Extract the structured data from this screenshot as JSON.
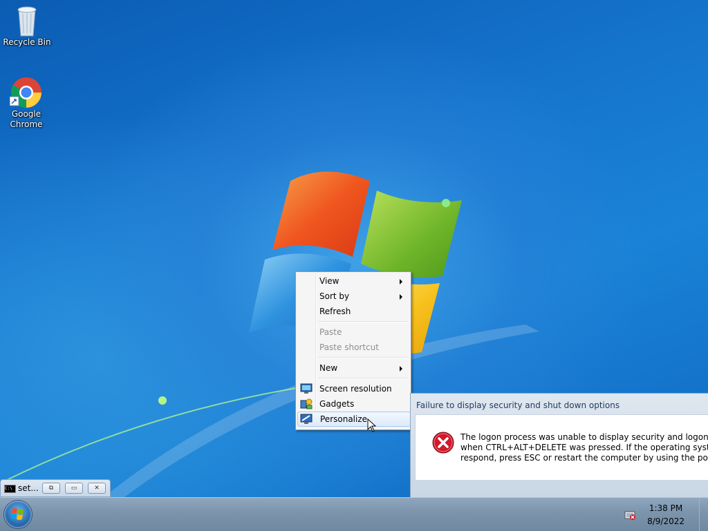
{
  "desktop": {
    "icons": [
      {
        "label": "Recycle Bin",
        "icon": "recycle-bin-icon"
      },
      {
        "label": "Google\nChrome",
        "icon": "chrome-icon"
      }
    ]
  },
  "context_menu": {
    "items": [
      {
        "label": "View",
        "submenu": true,
        "enabled": true
      },
      {
        "label": "Sort by",
        "submenu": true,
        "enabled": true
      },
      {
        "label": "Refresh",
        "enabled": true
      },
      {
        "label": "Paste",
        "enabled": false
      },
      {
        "label": "Paste shortcut",
        "enabled": false
      },
      {
        "label": "New",
        "submenu": true,
        "enabled": true
      },
      {
        "label": "Screen resolution",
        "icon": "monitor-icon",
        "enabled": true
      },
      {
        "label": "Gadgets",
        "icon": "gadgets-icon",
        "enabled": true
      },
      {
        "label": "Personalize",
        "icon": "personalize-icon",
        "enabled": true,
        "highlighted": true
      }
    ]
  },
  "dialog": {
    "title": "Failure to display security and shut down options",
    "message_line1": "The logon process was unable to display security and logon options",
    "message_line2": "when CTRL+ALT+DELETE was pressed. If the operating system does",
    "message_line3": "respond, press ESC or restart the computer by using the power switc"
  },
  "minimized_window": {
    "title": "set..."
  },
  "taskbar": {
    "time": "1:38 PM",
    "date": "8/9/2022"
  },
  "colors": {
    "desktop_blue": "#1677cf",
    "menu_background": "#f5f5f5",
    "error_red": "#d0192b"
  }
}
